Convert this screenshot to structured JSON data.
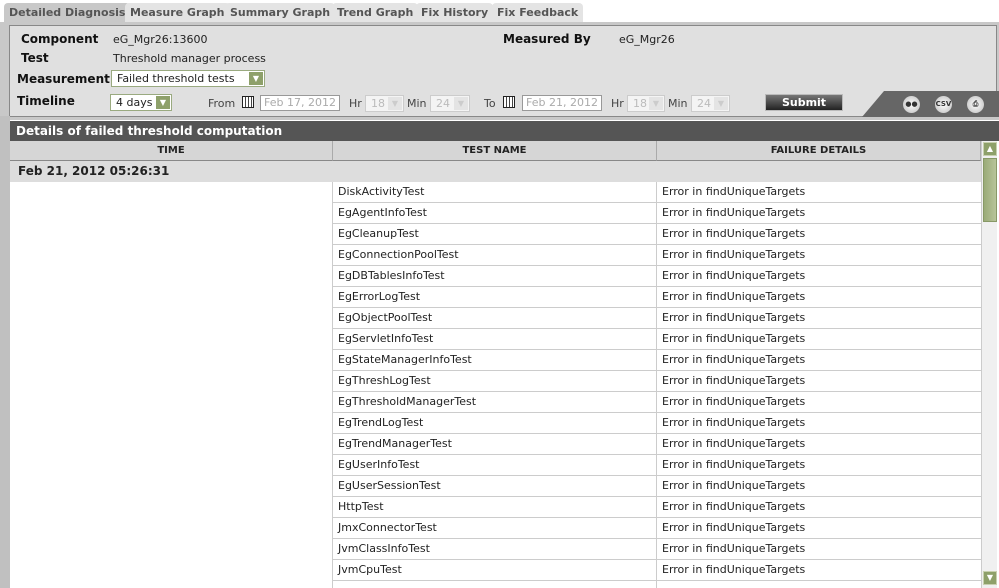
{
  "tabs": [
    "Detailed Diagnosis",
    "Measure Graph",
    "Summary Graph",
    "Trend Graph",
    "Fix History",
    "Fix Feedback"
  ],
  "filters": {
    "component_label": "Component",
    "component_value": "eG_Mgr26:13600",
    "measured_by_label": "Measured By",
    "measured_by_value": "eG_Mgr26",
    "test_label": "Test",
    "test_value": "Threshold manager process",
    "measurement_label": "Measurement",
    "measurement_value": "Failed threshold tests",
    "timeline_label": "Timeline",
    "timeline_value": "4 days",
    "from_label": "From",
    "from_date": "Feb 17, 2012",
    "from_hr": "18",
    "from_min": "24",
    "to_label": "To",
    "to_date": "Feb 21, 2012",
    "to_hr": "18",
    "to_min": "24",
    "hr_label": "Hr",
    "min_label": "Min",
    "submit": "Submit",
    "csv": "CSV"
  },
  "section_title": "Details of failed threshold computation",
  "columns": [
    "TIME",
    "TEST NAME",
    "FAILURE DETAILS"
  ],
  "date_group": "Feb 21, 2012 05:26:31",
  "rows": [
    [
      "DiskActivityTest",
      "Error in findUniqueTargets"
    ],
    [
      "EgAgentInfoTest",
      "Error in findUniqueTargets"
    ],
    [
      "EgCleanupTest",
      "Error in findUniqueTargets"
    ],
    [
      "EgConnectionPoolTest",
      "Error in findUniqueTargets"
    ],
    [
      "EgDBTablesInfoTest",
      "Error in findUniqueTargets"
    ],
    [
      "EgErrorLogTest",
      "Error in findUniqueTargets"
    ],
    [
      "EgObjectPoolTest",
      "Error in findUniqueTargets"
    ],
    [
      "EgServletInfoTest",
      "Error in findUniqueTargets"
    ],
    [
      "EgStateManagerInfoTest",
      "Error in findUniqueTargets"
    ],
    [
      "EgThreshLogTest",
      "Error in findUniqueTargets"
    ],
    [
      "EgThresholdManagerTest",
      "Error in findUniqueTargets"
    ],
    [
      "EgTrendLogTest",
      "Error in findUniqueTargets"
    ],
    [
      "EgTrendManagerTest",
      "Error in findUniqueTargets"
    ],
    [
      "EgUserInfoTest",
      "Error in findUniqueTargets"
    ],
    [
      "EgUserSessionTest",
      "Error in findUniqueTargets"
    ],
    [
      "HttpTest",
      "Error in findUniqueTargets"
    ],
    [
      "JmxConnectorTest",
      "Error in findUniqueTargets"
    ],
    [
      "JvmClassInfoTest",
      "Error in findUniqueTargets"
    ],
    [
      "JvmCpuTest",
      "Error in findUniqueTargets"
    ]
  ]
}
